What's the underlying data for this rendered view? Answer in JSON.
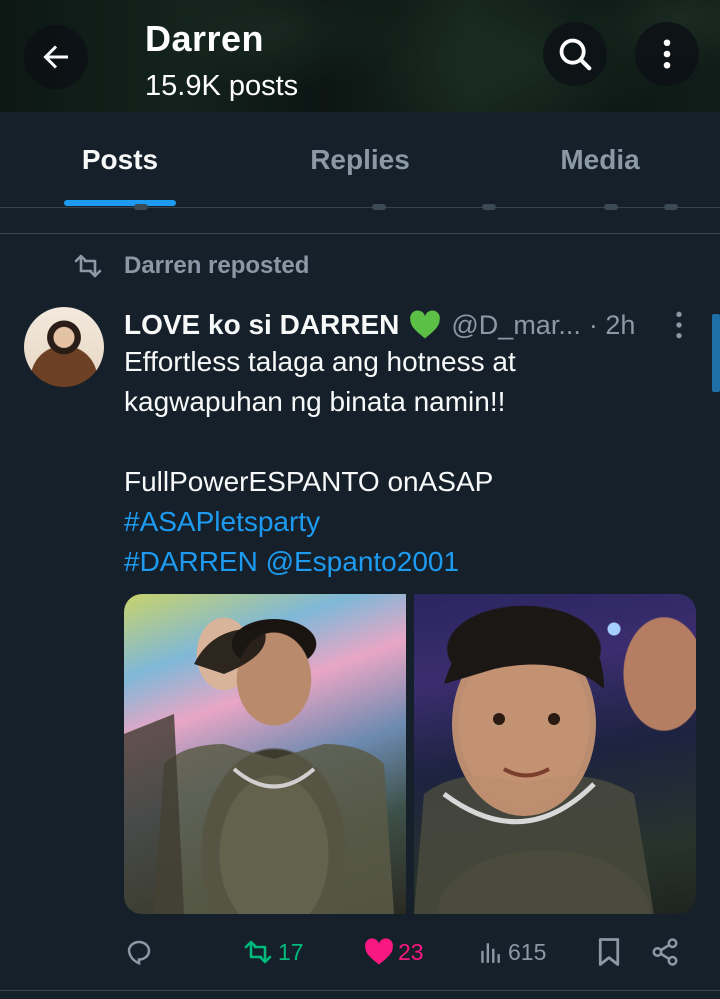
{
  "header": {
    "title": "Darren",
    "subtitle": "15.9K posts",
    "icons": {
      "back": "arrow-left-icon",
      "search": "search-icon",
      "more": "more-vertical-icon"
    }
  },
  "tabs": [
    {
      "label": "Posts",
      "active": true
    },
    {
      "label": "Replies",
      "active": false
    },
    {
      "label": "Media",
      "active": false
    }
  ],
  "post": {
    "repost_label": "Darren reposted",
    "author_name": "LOVE ko si DARREN",
    "author_emoji": "green-heart-icon",
    "author_handle": "@D_mar...",
    "time": "· 2h",
    "text_lines": [
      "Effortless talaga ang hotness at",
      "kagwapuhan ng binata namin!!",
      "",
      "FullPowerESPANTO onASAP"
    ],
    "hashtag_line1": "#ASAPletsparty",
    "hashtag_line2": "#DARREN @Espanto2001",
    "stats": {
      "reposts": "17",
      "likes": "23",
      "views": "615"
    }
  },
  "colors": {
    "background": "#15202b",
    "accent": "#1d9bf0",
    "repost_green": "#00ba7c",
    "like_pink": "#f91880",
    "muted": "#8b98a5"
  }
}
